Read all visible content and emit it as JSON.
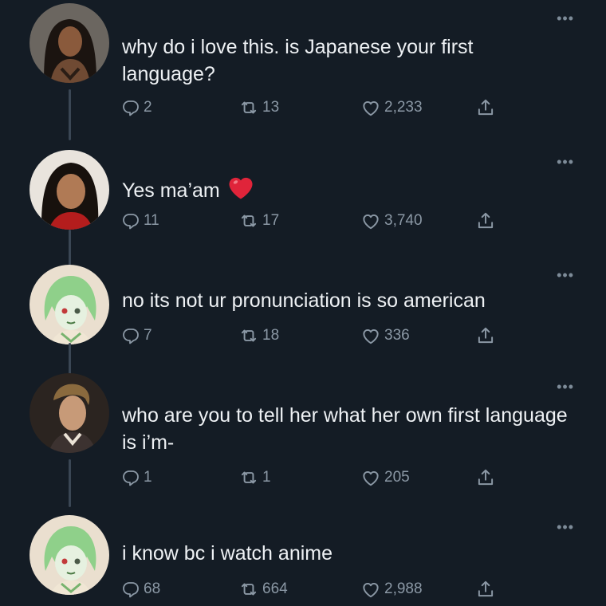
{
  "colors": {
    "background": "#141c25",
    "text": "#eef1f4",
    "muted": "#8b98a5",
    "thread_line": "#3a4654",
    "heart_emoji": "#e0243a"
  },
  "icons": {
    "reply": "reply-icon",
    "retweet": "retweet-icon",
    "like": "like-icon",
    "share": "share-icon",
    "more": "more-icon"
  },
  "tweets": [
    {
      "more": "•••",
      "text": "why do i love this. is Japanese your first language?",
      "replies": "2",
      "retweets": "13",
      "likes": "2,233"
    },
    {
      "more": "•••",
      "text": "Yes ma’am",
      "emoji": "red-heart-emoji",
      "replies": "11",
      "retweets": "17",
      "likes": "3,740"
    },
    {
      "more": "•••",
      "text": "no its not ur pronunciation is so american",
      "replies": "7",
      "retweets": "18",
      "likes": "336"
    },
    {
      "more": "•••",
      "text": "who are you to tell her what her own first language is i’m-",
      "replies": "1",
      "retweets": "1",
      "likes": "205"
    },
    {
      "more": "•••",
      "text": "i know bc i watch anime",
      "replies": "68",
      "retweets": "664",
      "likes": "2,988"
    }
  ]
}
